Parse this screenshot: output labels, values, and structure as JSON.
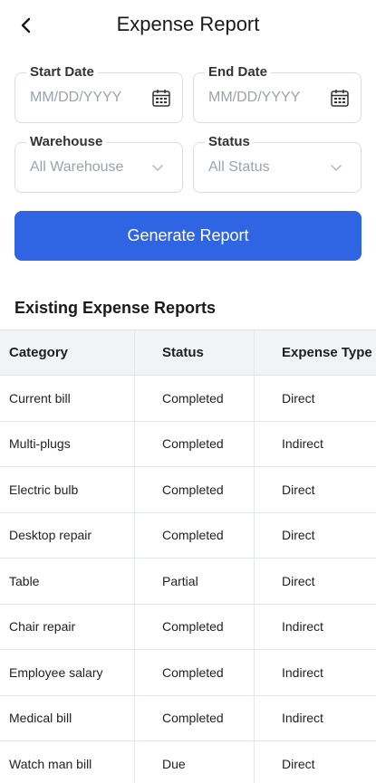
{
  "header": {
    "title": "Expense Report"
  },
  "form": {
    "start_date": {
      "label": "Start Date",
      "placeholder": "MM/DD/YYYY"
    },
    "end_date": {
      "label": "End Date",
      "placeholder": "MM/DD/YYYY"
    },
    "warehouse": {
      "label": "Warehouse",
      "value": "All Warehouse"
    },
    "status": {
      "label": "Status",
      "value": "All Status"
    },
    "generate_label": "Generate Report"
  },
  "reports": {
    "title": "Existing Expense Reports",
    "columns": [
      "Category",
      "Status",
      "Expense Type"
    ],
    "rows": [
      [
        "Current bill",
        "Completed",
        "Direct"
      ],
      [
        "Multi-plugs",
        "Completed",
        "Indirect"
      ],
      [
        "Electric bulb",
        "Completed",
        "Direct"
      ],
      [
        "Desktop repair",
        "Completed",
        "Direct"
      ],
      [
        "Table",
        "Partial",
        "Direct"
      ],
      [
        "Chair repair",
        "Completed",
        "Indirect"
      ],
      [
        "Employee salary",
        "Completed",
        "Indirect"
      ],
      [
        "Medical bill",
        "Completed",
        "Indirect"
      ],
      [
        "Watch man bill",
        "Due",
        "Direct"
      ]
    ]
  },
  "colors": {
    "primary": "#2f65e3",
    "border": "#d9dde3",
    "header_bg": "#f2f3f5"
  },
  "icons": {
    "back": "chevron-left-icon",
    "date": "calendar-icon",
    "select": "chevron-down-icon"
  }
}
